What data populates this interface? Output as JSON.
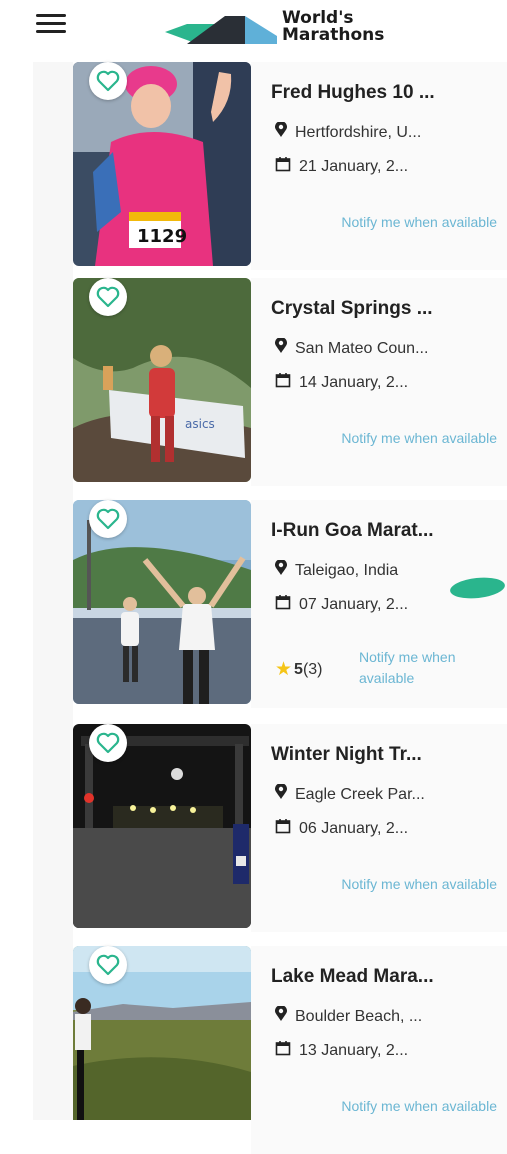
{
  "header": {
    "menu_icon": "hamburger-menu-icon",
    "logo_line1": "World's",
    "logo_line2": "Marathons"
  },
  "events": [
    {
      "title": "Fred Hughes 10 ...",
      "location": "Hertfordshire, U...",
      "date": "21 January, 2...",
      "notify": "Notify me when available"
    },
    {
      "title": "Crystal Springs ...",
      "location": "San Mateo Coun...",
      "date": "14 January, 2...",
      "notify": "Notify me when available"
    },
    {
      "title": "I-Run Goa Marat...",
      "location": "Taleigao, India",
      "date": "07 January, 2...",
      "rating_value": "5",
      "rating_count": "(3)",
      "notify": "Notify me when available"
    },
    {
      "title": "Winter Night Tr...",
      "location": "Eagle Creek Par...",
      "date": "06 January, 2...",
      "notify": "Notify me when available"
    },
    {
      "title": "Lake Mead Mara...",
      "location": "Boulder Beach, ...",
      "date": "13 January, 2...",
      "notify": "Notify me when available"
    }
  ],
  "icons": {
    "favorite": "heart-outline-icon",
    "location": "map-pin-icon",
    "date": "calendar-icon",
    "rating": "star-icon"
  },
  "colors": {
    "accent_green": "#2ab58d",
    "notify_blue": "#6bb6d3",
    "star_yellow": "#f5c518"
  }
}
